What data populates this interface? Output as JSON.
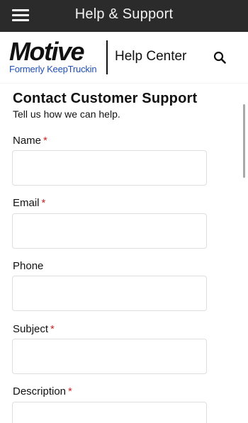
{
  "topbar": {
    "title": "Help & Support",
    "menu_icon": "hamburger-menu-icon"
  },
  "header": {
    "logo_text": "Motive",
    "logo_subtext": "Formerly KeepTruckin",
    "section_title": "Help Center",
    "search_icon": "search-icon"
  },
  "form": {
    "title": "Contact Customer Support",
    "subtitle": "Tell us how we can help.",
    "required_marker": "*",
    "fields": [
      {
        "label": "Name",
        "required": true,
        "value": ""
      },
      {
        "label": "Email",
        "required": true,
        "value": ""
      },
      {
        "label": "Phone",
        "required": false,
        "value": ""
      },
      {
        "label": "Subject",
        "required": true,
        "value": ""
      },
      {
        "label": "Description",
        "required": true,
        "value": ""
      }
    ]
  },
  "colors": {
    "topbar_bg": "#2b2b2b",
    "brand_blue": "#1f4fb4",
    "required_red": "#c62828"
  }
}
